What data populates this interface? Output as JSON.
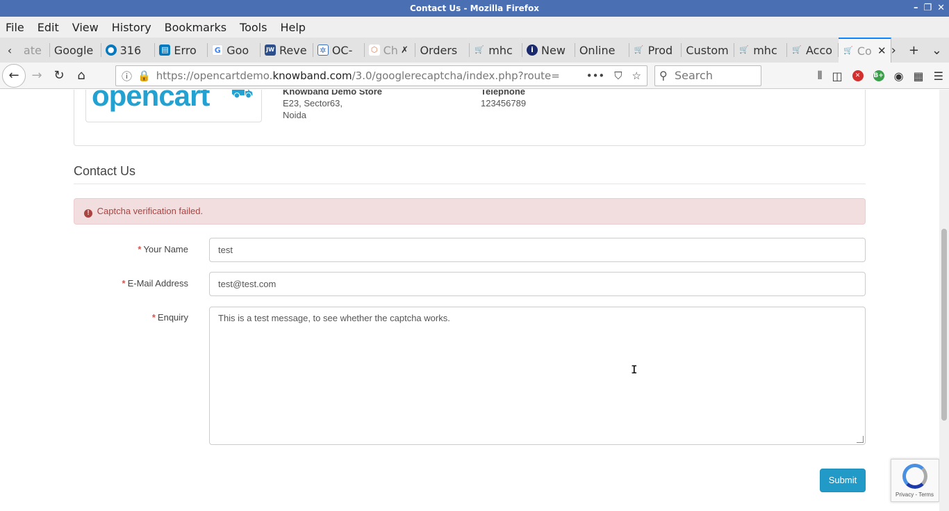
{
  "window": {
    "title": "Contact Us - Mozilla Firefox",
    "controls": [
      "–",
      "❐",
      "✕"
    ]
  },
  "menu": {
    "items": [
      "File",
      "Edit",
      "View",
      "History",
      "Bookmarks",
      "Tools",
      "Help"
    ]
  },
  "tabs": [
    {
      "label": "ate",
      "icon": ""
    },
    {
      "label": "Google",
      "icon": ""
    },
    {
      "label": "316",
      "icon": "drupal-icon",
      "color": "#0678be"
    },
    {
      "label": "Erro",
      "icon": "trello-icon",
      "color": "#0079bf"
    },
    {
      "label": "Goo",
      "icon": "google-icon",
      "color": "#4285f4"
    },
    {
      "label": "Reve",
      "icon": "jw-icon",
      "color": "#2c4f8c"
    },
    {
      "label": "OC-",
      "icon": "jira-icon",
      "color": "#3b6fb6"
    },
    {
      "label": "Ch",
      "icon": "hex-icon",
      "color": "#e07a4b"
    },
    {
      "label": "Orders",
      "icon": ""
    },
    {
      "label": "mhc",
      "icon": "cart-icon",
      "color": "#888"
    },
    {
      "label": "New",
      "icon": "info-icon",
      "color": "#1a2a6c"
    },
    {
      "label": "Online",
      "icon": ""
    },
    {
      "label": "Prod",
      "icon": "cart-icon",
      "color": "#888"
    },
    {
      "label": "Custom",
      "icon": ""
    },
    {
      "label": "mhc",
      "icon": "cart-icon",
      "color": "#888"
    },
    {
      "label": "Acco",
      "icon": "cart-icon",
      "color": "#888"
    },
    {
      "label": "Co",
      "icon": "cart-icon",
      "color": "#888",
      "active": true
    }
  ],
  "nav": {
    "url_prefix": "https://opencartdemo.",
    "url_domain": "knowband.com",
    "url_path": "/3.0/googlerecaptcha/index.php?route=",
    "search_placeholder": "Search"
  },
  "store": {
    "logo_text": "opencart",
    "name": "Knowband Demo Store",
    "address_line1": "E23, Sector63,",
    "address_line2": "Noida",
    "phone_heading": "Telephone",
    "phone": "123456789"
  },
  "form": {
    "title": "Contact Us",
    "alert": "Captcha verification failed.",
    "name_label": "Your Name",
    "name_value": "test",
    "email_label": "E-Mail Address",
    "email_value": "test@test.com",
    "enquiry_label": "Enquiry",
    "enquiry_value": "This is a test message, to see whether the captcha works.",
    "submit_label": "Submit",
    "required_mark": "*"
  },
  "recaptcha": {
    "footer": "Privacy - Terms"
  },
  "colors": {
    "accent": "#229ac8",
    "alert_bg": "#f2dede",
    "alert_text": "#a94442",
    "titlebar": "#4a6fb3"
  }
}
